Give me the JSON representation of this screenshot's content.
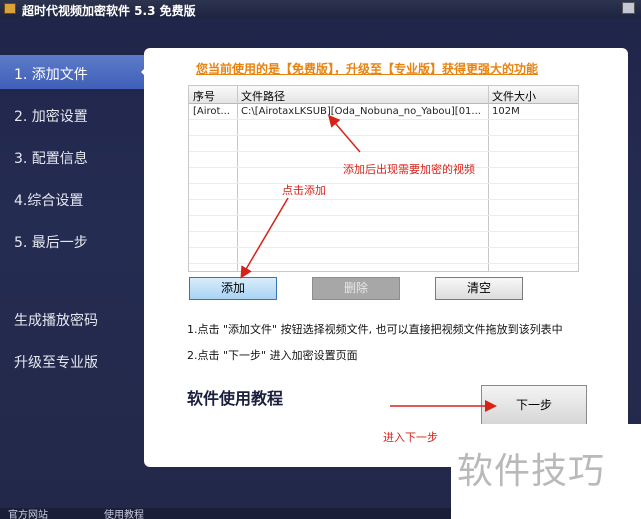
{
  "window": {
    "title": "超时代视频加密软件 5.3 免费版",
    "icon": "app-icon"
  },
  "sidebar": {
    "items": [
      {
        "label": "1. 添加文件",
        "active": true
      },
      {
        "label": "2. 加密设置",
        "active": false
      },
      {
        "label": "3. 配置信息",
        "active": false
      },
      {
        "label": "4.综合设置",
        "active": false
      },
      {
        "label": "5. 最后一步",
        "active": false
      },
      {
        "label": "生成播放密码",
        "active": false
      },
      {
        "label": "升级至专业版",
        "active": false
      }
    ]
  },
  "main": {
    "promo": "您当前使用的是【免费版】，升级至【专业版】获得更强大的功能",
    "table": {
      "columns": [
        "序号",
        "文件路径",
        "文件大小"
      ],
      "rows": [
        {
          "index": "[Airot...",
          "path": "C:\\[AirotaxLKSUB][Oda_Nobuna_no_Yabou][01...",
          "size": "102M"
        }
      ]
    },
    "buttons": {
      "add": "添加",
      "delete": "删除",
      "clear": "清空",
      "next": "下一步"
    },
    "hints": [
      "1.点击 \"添加文件\" 按钮选择视频文件, 也可以直接把视频文件拖放到该列表中",
      "2.点击 \"下一步\" 进入加密设置页面"
    ],
    "tutorial_title": "软件使用教程"
  },
  "annotations": {
    "video_note": "添加后出现需要加密的视频",
    "click_add": "点击添加",
    "next_step": "进入下一步"
  },
  "bottom": {
    "left": "官方网站",
    "middle": "使用教程"
  },
  "watermark": "软件技巧",
  "colors": {
    "sidebar_bg": "#20254a",
    "active_item": "#4a67bf",
    "promo_text": "#e88310",
    "annotation": "#d6231a"
  }
}
